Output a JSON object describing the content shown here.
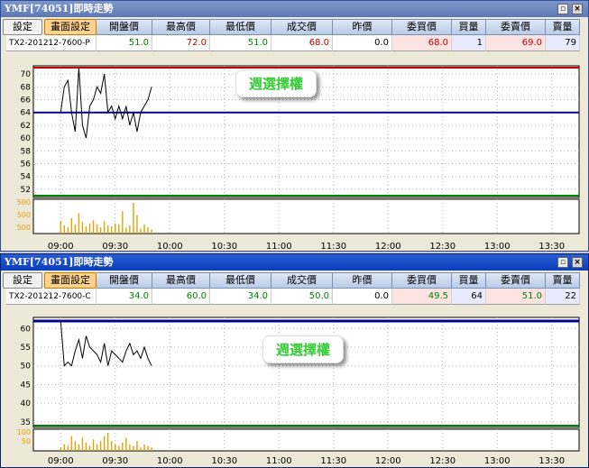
{
  "windows": [
    {
      "title": "YMF[74051]即時走勢",
      "settings_label": "設定",
      "screen_settings_label": "畫面設定",
      "headers": [
        "開盤價",
        "最高價",
        "最低價",
        "成交價",
        "昨價",
        "委買價",
        "買量",
        "委賣價",
        "賣量"
      ],
      "symbol": "TX2-201212-7600-P",
      "values": [
        "51.0",
        "72.0",
        "51.0",
        "68.0",
        "0.0",
        "68.0",
        "1",
        "69.0",
        "79"
      ],
      "popup": "週選擇權",
      "y_ticks": [
        "70",
        "68",
        "66",
        "64",
        "62",
        "60",
        "58",
        "56",
        "54",
        "52"
      ],
      "vol_ticks": [
        "500",
        "500",
        "500"
      ],
      "x_ticks": [
        "09:00",
        "09:30",
        "10:00",
        "10:30",
        "11:00",
        "11:30",
        "12:00",
        "12:30",
        "13:00",
        "13:30"
      ]
    },
    {
      "title": "YMF[74051]即時走勢",
      "settings_label": "設定",
      "screen_settings_label": "畫面設定",
      "headers": [
        "開盤價",
        "最高價",
        "最低價",
        "成交價",
        "昨價",
        "委買價",
        "買量",
        "委賣價",
        "賣量"
      ],
      "symbol": "TX2-201212-7600-C",
      "values": [
        "34.0",
        "60.0",
        "34.0",
        "50.0",
        "0.0",
        "49.5",
        "64",
        "51.0",
        "22"
      ],
      "popup": "週選擇權",
      "y_ticks": [
        "60",
        "55",
        "50",
        "45",
        "40",
        "35"
      ],
      "vol_ticks": [
        "100",
        "50"
      ],
      "x_ticks": [
        "09:00",
        "09:30",
        "10:00",
        "10:30",
        "11:00",
        "11:30",
        "12:00",
        "12:30",
        "13:00",
        "13:30"
      ]
    }
  ],
  "colors": {
    "red_value": "#c00000",
    "green_value": "#008000",
    "price_line": "#000000",
    "ref_line_blue": "#00008b",
    "high_line_red": "#c00000",
    "low_line_green": "#008000",
    "volume": "#e8a000",
    "popup_text": "#33cc33"
  },
  "chart_data": [
    {
      "type": "line",
      "series": [
        {
          "x": [
            "09:00",
            "09:02",
            "09:04",
            "09:06",
            "09:08",
            "09:10",
            "09:12",
            "09:14",
            "09:16",
            "09:18",
            "09:20",
            "09:22",
            "09:24",
            "09:26",
            "09:28",
            "09:30",
            "09:32",
            "09:34",
            "09:36",
            "09:38",
            "09:40",
            "09:42",
            "09:44",
            "09:46",
            "09:48",
            "09:50"
          ],
          "values": [
            64,
            68,
            69,
            64,
            61,
            71,
            62,
            60,
            65,
            66,
            68,
            67,
            70,
            64,
            65,
            63,
            65,
            63,
            65,
            62,
            64,
            61,
            64,
            65,
            66,
            68
          ]
        }
      ],
      "reference_lines": [
        71.0,
        64.0,
        51.0
      ],
      "ylim": [
        51,
        71
      ],
      "volume": [
        120,
        80,
        60,
        150,
        90,
        200,
        110,
        70,
        100,
        130,
        90,
        60,
        120,
        80,
        70,
        100,
        90,
        220,
        60,
        80,
        300,
        180,
        50,
        90,
        60,
        40
      ]
    },
    {
      "type": "line",
      "series": [
        {
          "x": [
            "09:00",
            "09:02",
            "09:04",
            "09:06",
            "09:08",
            "09:10",
            "09:12",
            "09:14",
            "09:16",
            "09:18",
            "09:20",
            "09:22",
            "09:24",
            "09:26",
            "09:28",
            "09:30",
            "09:32",
            "09:34",
            "09:36",
            "09:38",
            "09:40",
            "09:42",
            "09:44",
            "09:46",
            "09:48",
            "09:50"
          ],
          "values": [
            62,
            50,
            51,
            50,
            54,
            57,
            52,
            58,
            55,
            54,
            53,
            51,
            56,
            50,
            54,
            53,
            52,
            51,
            54,
            56,
            53,
            54,
            52,
            55,
            52,
            50
          ]
        }
      ],
      "reference_lines": [
        62.0,
        34.0
      ],
      "ylim": [
        34,
        62
      ],
      "volume": [
        20,
        40,
        30,
        90,
        60,
        40,
        80,
        50,
        30,
        70,
        40,
        60,
        90,
        110,
        60,
        40,
        30,
        50,
        80,
        40,
        30,
        60,
        20,
        40,
        30,
        20
      ]
    }
  ]
}
